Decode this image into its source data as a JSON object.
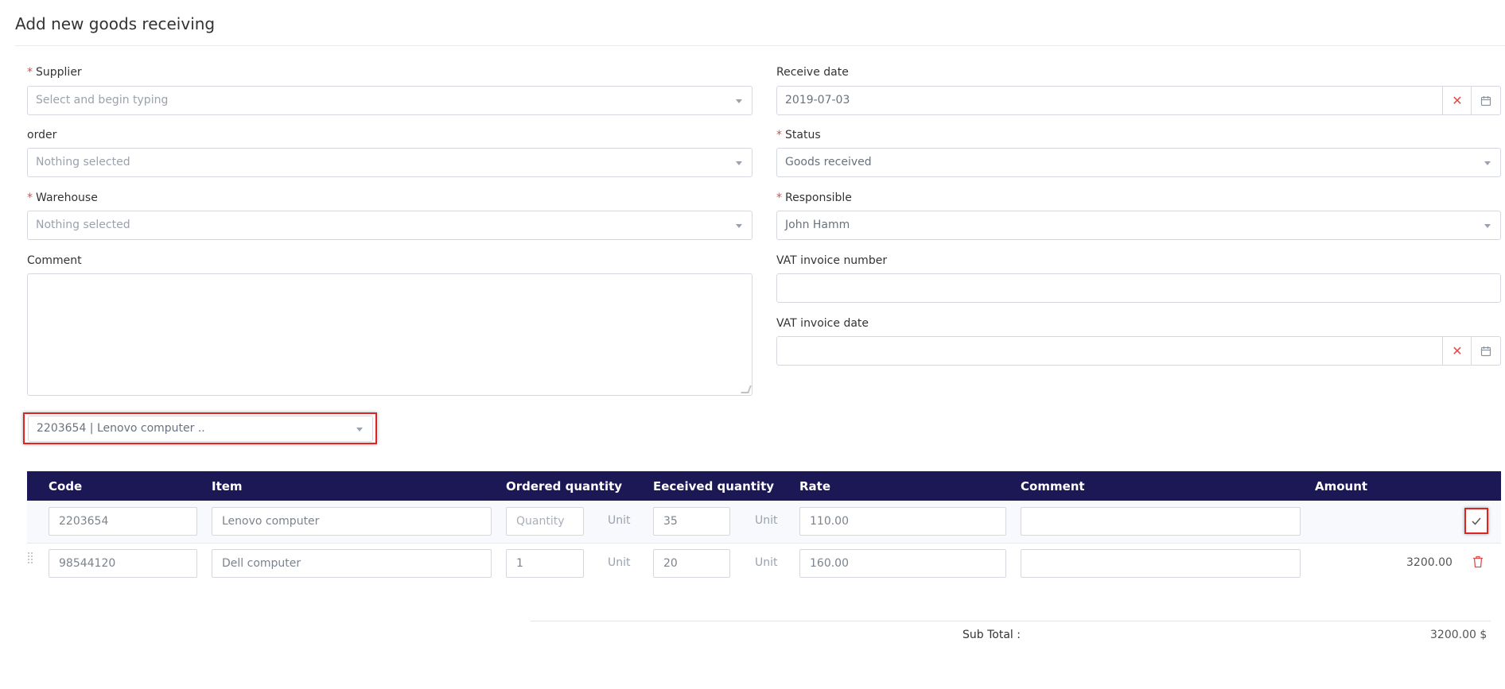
{
  "page": {
    "title": "Add new goods receiving"
  },
  "form": {
    "supplier": {
      "label": "Supplier",
      "placeholder": "Select and begin typing"
    },
    "order": {
      "label": "order",
      "placeholder": "Nothing selected"
    },
    "warehouse": {
      "label": "Warehouse",
      "placeholder": "Nothing selected"
    },
    "comment": {
      "label": "Comment",
      "value": ""
    },
    "receive_date": {
      "label": "Receive date",
      "value": "2019-07-03"
    },
    "status": {
      "label": "Status",
      "value": "Goods received"
    },
    "responsible": {
      "label": "Responsible",
      "value": "John Hamm"
    },
    "vat_invoice_number": {
      "label": "VAT invoice number",
      "value": ""
    },
    "vat_invoice_date": {
      "label": "VAT invoice date",
      "value": ""
    },
    "required_mark": "*"
  },
  "item_select": {
    "value": "2203654 | Lenovo computer .."
  },
  "table": {
    "columns": [
      "Code",
      "Item",
      "Ordered quantity",
      "Eeceived quantity",
      "Rate",
      "Comment",
      "Amount"
    ],
    "new_row": {
      "code": "2203654",
      "item": "Lenovo computer",
      "ordered_placeholder": "Quantity",
      "ordered_unit": "Unit",
      "received": "35",
      "received_unit": "Unit",
      "rate": "110.00",
      "comment": ""
    },
    "rows": [
      {
        "code": "98544120",
        "item": "Dell computer",
        "ordered": "1",
        "ordered_unit": "Unit",
        "received": "20",
        "received_unit": "Unit",
        "rate": "160.00",
        "comment": "",
        "amount": "3200.00"
      }
    ]
  },
  "totals": {
    "subtotal_label": "Sub Total :",
    "subtotal_value": "3200.00 $"
  },
  "colors": {
    "header_bg": "#1c1856",
    "required": "#e24b4b",
    "highlight": "#e02424"
  }
}
